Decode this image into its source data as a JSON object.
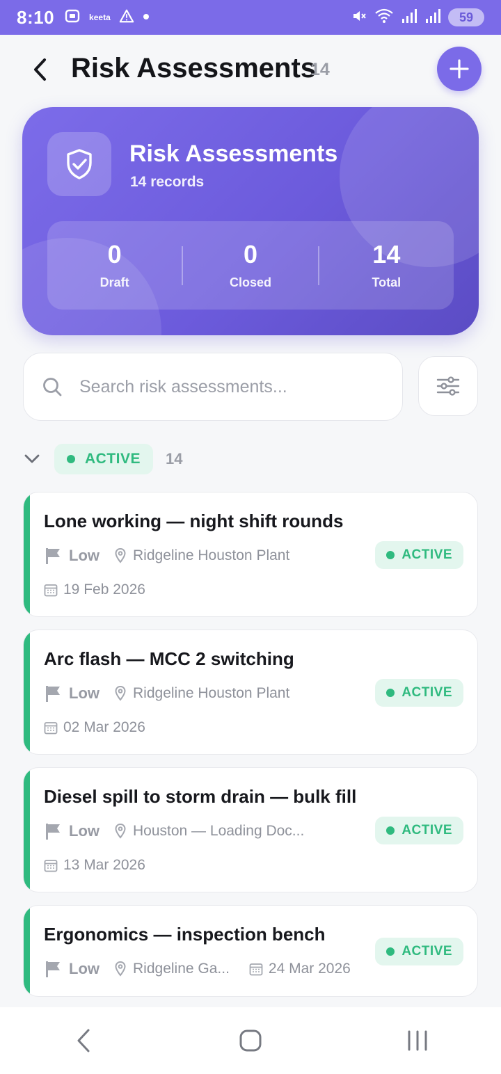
{
  "status_bar": {
    "time": "8:10",
    "app_label": "keeta",
    "battery": "59"
  },
  "header": {
    "title": "Risk Assessments",
    "count": "14"
  },
  "summary": {
    "title": "Risk Assessments",
    "subtitle": "14 records",
    "stats": [
      {
        "value": "0",
        "label": "Draft"
      },
      {
        "value": "0",
        "label": "Closed"
      },
      {
        "value": "14",
        "label": "Total"
      }
    ]
  },
  "search": {
    "placeholder": "Search risk assessments..."
  },
  "group": {
    "label": "ACTIVE",
    "count": "14",
    "color": "#2fba7f"
  },
  "assessments": [
    {
      "title": "Lone working — night shift rounds",
      "severity": "Low",
      "location": "Ridgeline Houston Plant",
      "date": "19 Feb 2026",
      "status": "ACTIVE"
    },
    {
      "title": "Arc flash — MCC 2 switching",
      "severity": "Low",
      "location": "Ridgeline Houston Plant",
      "date": "02 Mar 2026",
      "status": "ACTIVE"
    },
    {
      "title": "Diesel spill to storm drain — bulk fill",
      "severity": "Low",
      "location": "Houston — Loading Doc...",
      "date": "13 Mar 2026",
      "status": "ACTIVE"
    },
    {
      "title": "Ergonomics — inspection bench",
      "severity": "Low",
      "location": "Ridgeline Ga...",
      "date": "24 Mar 2026",
      "status": "ACTIVE"
    }
  ],
  "theme": {
    "accent": "#7b6be8",
    "active_green": "#2fba7f"
  }
}
